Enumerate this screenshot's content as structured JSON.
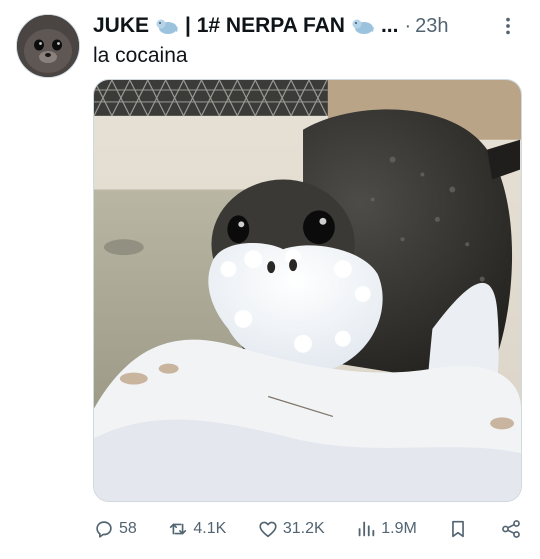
{
  "tweet": {
    "author_name": "JUKE",
    "author_title": "| 1# NERPA FAN",
    "name_truncation": "...",
    "separator": "·",
    "timestamp": "23h",
    "text": "la cocaina",
    "name_emoji_icon": "seal-emoji-icon",
    "media_description_icon": "seal-photo"
  },
  "actions": {
    "replies": "58",
    "reposts": "4.1K",
    "likes": "31.2K",
    "views": "1.9M"
  },
  "colors": {
    "text_primary": "#0f1419",
    "text_secondary": "#536471",
    "border": "#cfd9de"
  }
}
